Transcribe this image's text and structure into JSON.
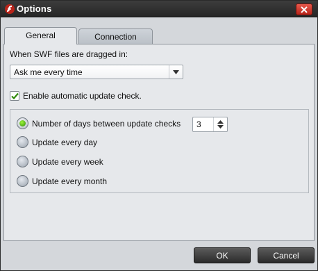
{
  "window": {
    "title": "Options",
    "icon": "flash-player-icon",
    "close_icon": "close-icon"
  },
  "tabs": [
    {
      "label": "General",
      "active": true
    },
    {
      "label": "Connection",
      "active": false
    }
  ],
  "general": {
    "swf_label": "When SWF files are dragged in:",
    "swf_dropdown": {
      "value": "Ask me every time"
    },
    "auto_update": {
      "label": "Enable automatic update check.",
      "checked": true
    },
    "update_options": [
      {
        "label": "Number of days between update checks",
        "selected": true
      },
      {
        "label": "Update every day",
        "selected": false
      },
      {
        "label": "Update every week",
        "selected": false
      },
      {
        "label": "Update every month",
        "selected": false
      }
    ],
    "days_spinner": {
      "value": "3"
    }
  },
  "buttons": {
    "ok": "OK",
    "cancel": "Cancel"
  },
  "colors": {
    "titlebar": "#2f2f2f",
    "close_button": "#d23a2c",
    "radio_selected": "#5ac41c",
    "checkbox_check": "#2f8a0a"
  }
}
